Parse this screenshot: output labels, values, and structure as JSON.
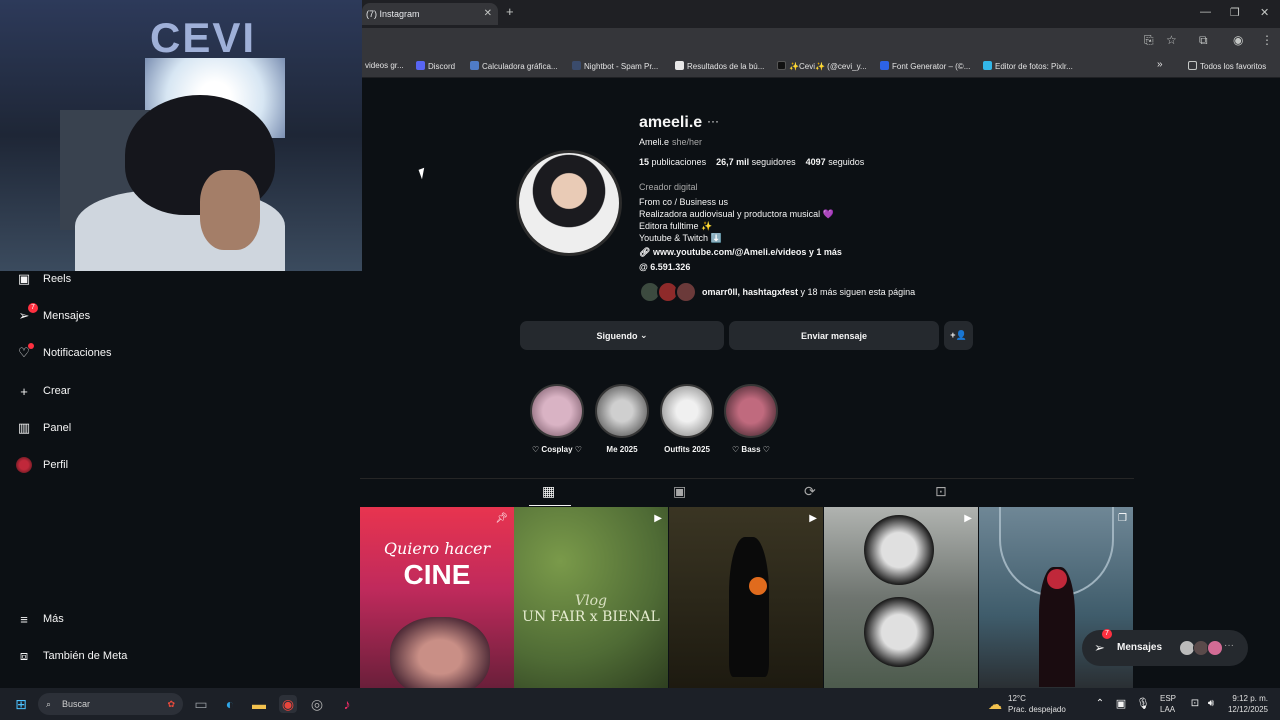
{
  "browser": {
    "tab_title": "(7) Instagram",
    "bookmarks": [
      {
        "label": "videos gr..."
      },
      {
        "label": "Discord"
      },
      {
        "label": "Calculadora gráfica..."
      },
      {
        "label": "Nightbot - Spam Pr..."
      },
      {
        "label": "Resultados de la bú..."
      },
      {
        "label": "✨Cevi✨ (@cevi_y..."
      },
      {
        "label": "Font Generator – (©..."
      },
      {
        "label": "Editor de fotos: Pixlr..."
      }
    ],
    "all_favorites": "Todos los favoritos"
  },
  "nav": {
    "reels": "Reels",
    "messages": "Mensajes",
    "messages_badge": "7",
    "notifications": "Notificaciones",
    "create": "Crear",
    "panel": "Panel",
    "profile": "Perfil",
    "more": "Más",
    "also_meta": "También de Meta"
  },
  "profile": {
    "username": "ameeli.e",
    "more_icon": "···",
    "full_name": "Ameli.e",
    "pronouns": "she/her",
    "posts_count": "15",
    "posts_label": "publicaciones",
    "followers_count": "26,7 mil",
    "followers_label": "seguidores",
    "following_count": "4097",
    "following_label": "seguidos",
    "category": "Creador digital",
    "bio_lines": [
      "From co / Business us",
      "Realizadora audiovisual y productora musical 💜",
      "Editora fulltime ✨",
      "Youtube & Twitch ⬇️"
    ],
    "link": "www.youtube.com/@Ameli.e/videos y 1 más",
    "threads": "6.591.326",
    "mutual_names": "omarr0ll, hashtagxfest",
    "mutual_rest": " y 18 más siguen esta página",
    "following_button": "Siguendo",
    "following_chevron": "⌄",
    "message_button": "Enviar mensaje",
    "add_user_icon": "+👤"
  },
  "highlights": [
    {
      "label": "♡ Cosplay ♡",
      "color": "#d9b3c4"
    },
    {
      "label": "Me 2025",
      "color": "#8a8a8a"
    },
    {
      "label": "Outfits 2025",
      "color": "#cfcfcf"
    },
    {
      "label": "♡ Bass ♡",
      "color": "#c06a7e"
    }
  ],
  "posts": [
    {
      "line1": "Quiero hacer",
      "line2": "CINE",
      "bg": "#c9325f"
    },
    {
      "line1": "Vlog",
      "line2": "UN FAIR x BIENAL",
      "bg": "#5f7c3e"
    },
    {
      "line1": "",
      "line2": "",
      "bg": "#2a2717"
    },
    {
      "line1": "",
      "line2": "",
      "bg": "#8a8d88"
    },
    {
      "line1": "",
      "line2": "",
      "bg": "#3f5c6b"
    }
  ],
  "messages_pill": {
    "label": "Mensajes",
    "badge": "7"
  },
  "taskbar": {
    "search_placeholder": "Buscar",
    "temp": "12°C",
    "weather": "Prac. despejado",
    "lang1": "ESP",
    "lang2": "LAA",
    "time": "9:12 p. m.",
    "date": "12/12/2025"
  }
}
